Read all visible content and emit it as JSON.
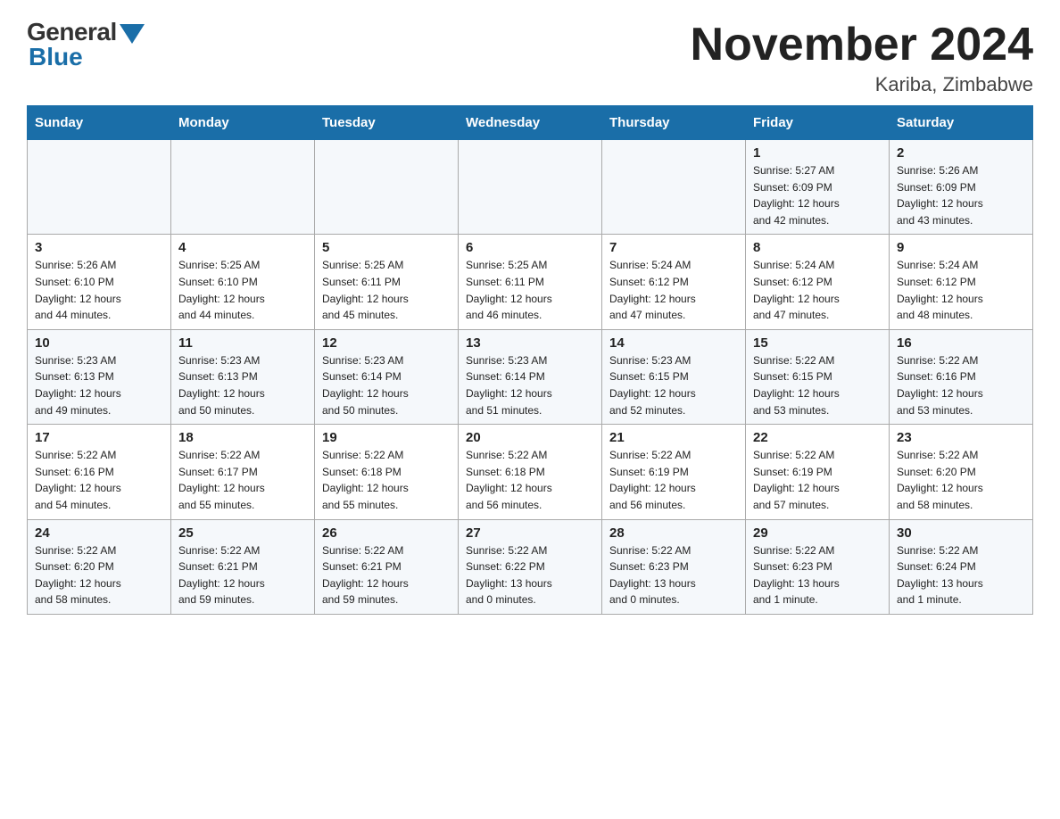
{
  "logo": {
    "general": "General",
    "blue": "Blue"
  },
  "title": "November 2024",
  "location": "Kariba, Zimbabwe",
  "days_of_week": [
    "Sunday",
    "Monday",
    "Tuesday",
    "Wednesday",
    "Thursday",
    "Friday",
    "Saturday"
  ],
  "weeks": [
    [
      {
        "day": "",
        "info": ""
      },
      {
        "day": "",
        "info": ""
      },
      {
        "day": "",
        "info": ""
      },
      {
        "day": "",
        "info": ""
      },
      {
        "day": "",
        "info": ""
      },
      {
        "day": "1",
        "info": "Sunrise: 5:27 AM\nSunset: 6:09 PM\nDaylight: 12 hours\nand 42 minutes."
      },
      {
        "day": "2",
        "info": "Sunrise: 5:26 AM\nSunset: 6:09 PM\nDaylight: 12 hours\nand 43 minutes."
      }
    ],
    [
      {
        "day": "3",
        "info": "Sunrise: 5:26 AM\nSunset: 6:10 PM\nDaylight: 12 hours\nand 44 minutes."
      },
      {
        "day": "4",
        "info": "Sunrise: 5:25 AM\nSunset: 6:10 PM\nDaylight: 12 hours\nand 44 minutes."
      },
      {
        "day": "5",
        "info": "Sunrise: 5:25 AM\nSunset: 6:11 PM\nDaylight: 12 hours\nand 45 minutes."
      },
      {
        "day": "6",
        "info": "Sunrise: 5:25 AM\nSunset: 6:11 PM\nDaylight: 12 hours\nand 46 minutes."
      },
      {
        "day": "7",
        "info": "Sunrise: 5:24 AM\nSunset: 6:12 PM\nDaylight: 12 hours\nand 47 minutes."
      },
      {
        "day": "8",
        "info": "Sunrise: 5:24 AM\nSunset: 6:12 PM\nDaylight: 12 hours\nand 47 minutes."
      },
      {
        "day": "9",
        "info": "Sunrise: 5:24 AM\nSunset: 6:12 PM\nDaylight: 12 hours\nand 48 minutes."
      }
    ],
    [
      {
        "day": "10",
        "info": "Sunrise: 5:23 AM\nSunset: 6:13 PM\nDaylight: 12 hours\nand 49 minutes."
      },
      {
        "day": "11",
        "info": "Sunrise: 5:23 AM\nSunset: 6:13 PM\nDaylight: 12 hours\nand 50 minutes."
      },
      {
        "day": "12",
        "info": "Sunrise: 5:23 AM\nSunset: 6:14 PM\nDaylight: 12 hours\nand 50 minutes."
      },
      {
        "day": "13",
        "info": "Sunrise: 5:23 AM\nSunset: 6:14 PM\nDaylight: 12 hours\nand 51 minutes."
      },
      {
        "day": "14",
        "info": "Sunrise: 5:23 AM\nSunset: 6:15 PM\nDaylight: 12 hours\nand 52 minutes."
      },
      {
        "day": "15",
        "info": "Sunrise: 5:22 AM\nSunset: 6:15 PM\nDaylight: 12 hours\nand 53 minutes."
      },
      {
        "day": "16",
        "info": "Sunrise: 5:22 AM\nSunset: 6:16 PM\nDaylight: 12 hours\nand 53 minutes."
      }
    ],
    [
      {
        "day": "17",
        "info": "Sunrise: 5:22 AM\nSunset: 6:16 PM\nDaylight: 12 hours\nand 54 minutes."
      },
      {
        "day": "18",
        "info": "Sunrise: 5:22 AM\nSunset: 6:17 PM\nDaylight: 12 hours\nand 55 minutes."
      },
      {
        "day": "19",
        "info": "Sunrise: 5:22 AM\nSunset: 6:18 PM\nDaylight: 12 hours\nand 55 minutes."
      },
      {
        "day": "20",
        "info": "Sunrise: 5:22 AM\nSunset: 6:18 PM\nDaylight: 12 hours\nand 56 minutes."
      },
      {
        "day": "21",
        "info": "Sunrise: 5:22 AM\nSunset: 6:19 PM\nDaylight: 12 hours\nand 56 minutes."
      },
      {
        "day": "22",
        "info": "Sunrise: 5:22 AM\nSunset: 6:19 PM\nDaylight: 12 hours\nand 57 minutes."
      },
      {
        "day": "23",
        "info": "Sunrise: 5:22 AM\nSunset: 6:20 PM\nDaylight: 12 hours\nand 58 minutes."
      }
    ],
    [
      {
        "day": "24",
        "info": "Sunrise: 5:22 AM\nSunset: 6:20 PM\nDaylight: 12 hours\nand 58 minutes."
      },
      {
        "day": "25",
        "info": "Sunrise: 5:22 AM\nSunset: 6:21 PM\nDaylight: 12 hours\nand 59 minutes."
      },
      {
        "day": "26",
        "info": "Sunrise: 5:22 AM\nSunset: 6:21 PM\nDaylight: 12 hours\nand 59 minutes."
      },
      {
        "day": "27",
        "info": "Sunrise: 5:22 AM\nSunset: 6:22 PM\nDaylight: 13 hours\nand 0 minutes."
      },
      {
        "day": "28",
        "info": "Sunrise: 5:22 AM\nSunset: 6:23 PM\nDaylight: 13 hours\nand 0 minutes."
      },
      {
        "day": "29",
        "info": "Sunrise: 5:22 AM\nSunset: 6:23 PM\nDaylight: 13 hours\nand 1 minute."
      },
      {
        "day": "30",
        "info": "Sunrise: 5:22 AM\nSunset: 6:24 PM\nDaylight: 13 hours\nand 1 minute."
      }
    ]
  ]
}
